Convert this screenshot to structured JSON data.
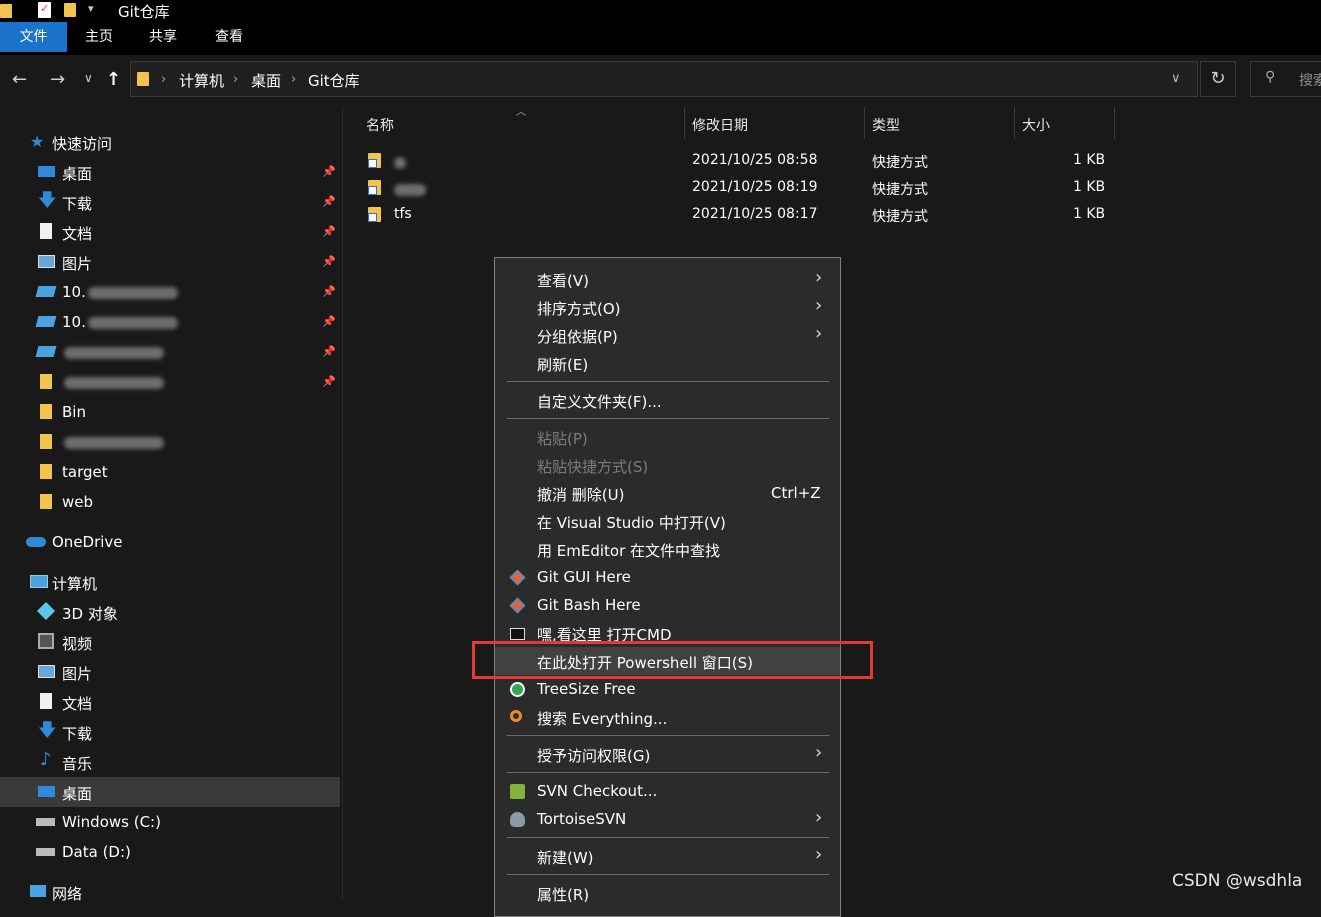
{
  "window": {
    "title": "Git仓库"
  },
  "ribbon": {
    "tabs": [
      "文件",
      "主页",
      "共享",
      "查看"
    ]
  },
  "address": {
    "segments": [
      "计算机",
      "桌面",
      "Git仓库"
    ]
  },
  "search": {
    "placeholder": "搜索"
  },
  "sidebar": {
    "quick_access": "快速访问",
    "items": [
      {
        "label": "桌面",
        "icon": "desktop-icon",
        "pinned": true
      },
      {
        "label": "下载",
        "icon": "download-icon",
        "pinned": true
      },
      {
        "label": "文档",
        "icon": "document-icon",
        "pinned": true
      },
      {
        "label": "图片",
        "icon": "picture-icon",
        "pinned": true
      },
      {
        "label": "10.",
        "icon": "network-drive-icon",
        "pinned": true
      },
      {
        "label": "10.",
        "icon": "network-drive-icon",
        "pinned": true
      },
      {
        "label": "",
        "icon": "network-drive-icon",
        "pinned": true
      },
      {
        "label": "",
        "icon": "folder-icon",
        "pinned": true
      },
      {
        "label": "Bin",
        "icon": "folder-icon",
        "pinned": false
      },
      {
        "label": "",
        "icon": "folder-icon",
        "pinned": false
      },
      {
        "label": "target",
        "icon": "folder-icon",
        "pinned": false
      },
      {
        "label": "web",
        "icon": "folder-icon",
        "pinned": false
      }
    ],
    "onedrive": "OneDrive",
    "computer": "计算机",
    "computer_items": [
      {
        "label": "3D 对象",
        "icon": "3d-objects-icon"
      },
      {
        "label": "视频",
        "icon": "video-icon"
      },
      {
        "label": "图片",
        "icon": "picture-icon"
      },
      {
        "label": "文档",
        "icon": "document-icon"
      },
      {
        "label": "下载",
        "icon": "download-icon"
      },
      {
        "label": "音乐",
        "icon": "music-icon"
      },
      {
        "label": "桌面",
        "icon": "desktop-icon",
        "selected": true
      },
      {
        "label": "Windows (C:)",
        "icon": "drive-icon"
      },
      {
        "label": "Data (D:)",
        "icon": "drive-icon"
      }
    ],
    "network": "网络"
  },
  "file_list": {
    "columns": [
      "名称",
      "修改日期",
      "类型",
      "大小"
    ],
    "rows": [
      {
        "name": "",
        "date": "2021/10/25 08:58",
        "type": "快捷方式",
        "size": "1 KB"
      },
      {
        "name": "",
        "date": "2021/10/25 08:19",
        "type": "快捷方式",
        "size": "1 KB"
      },
      {
        "name": "tfs",
        "date": "2021/10/25 08:17",
        "type": "快捷方式",
        "size": "1 KB"
      }
    ]
  },
  "context_menu": {
    "view": "查看(V)",
    "sort": "排序方式(O)",
    "group": "分组依据(P)",
    "refresh": "刷新(E)",
    "customize": "自定义文件夹(F)...",
    "paste": "粘贴(P)",
    "paste_shortcut": "粘贴快捷方式(S)",
    "undo": "撤消 删除(U)",
    "undo_accel": "Ctrl+Z",
    "open_vs": "在 Visual Studio 中打开(V)",
    "emeditor": "用 EmEditor 在文件中查找",
    "git_gui": "Git GUI Here",
    "git_bash": "Git Bash Here",
    "open_cmd": "嘿,看这里 打开CMD",
    "powershell": "在此处打开 Powershell 窗口(S)",
    "treesize": "TreeSize Free",
    "everything": "搜索 Everything...",
    "grant_access": "授予访问权限(G)",
    "svn_checkout": "SVN Checkout...",
    "tortoisesvn": "TortoiseSVN",
    "new": "新建(W)",
    "properties": "属性(R)"
  },
  "colors": {
    "highlight_box": "#e53935",
    "ribbon_active": "#1a73c8"
  },
  "watermark": "CSDN @wsdhla"
}
